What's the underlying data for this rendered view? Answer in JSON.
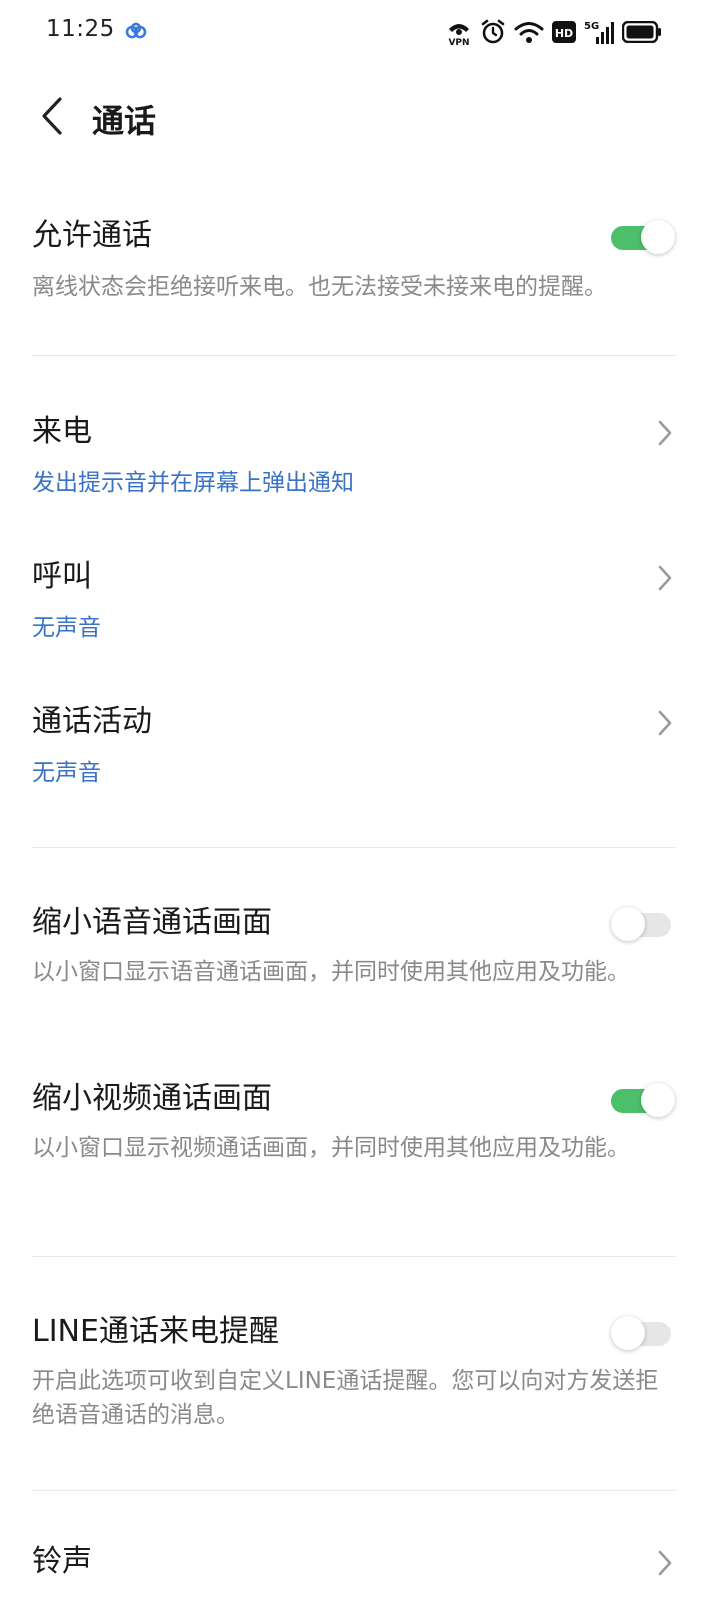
{
  "status_bar": {
    "time": "11:25",
    "icons": [
      "cloud-icon",
      "vpn-icon",
      "alarm-icon",
      "wifi-icon",
      "hd-icon",
      "5g-signal-icon",
      "battery-icon"
    ],
    "vpn_label": "VPN",
    "hd_label": "HD",
    "network_label": "5G"
  },
  "header": {
    "title": "通话",
    "back_icon": "chevron-left-icon"
  },
  "colors": {
    "toggle_on": "#4cbf6b",
    "toggle_off": "#e6e6e6",
    "value_blue": "#3a72c6",
    "desc_gray": "#8a8a8a"
  },
  "settings": {
    "allow_calls": {
      "title": "允许通话",
      "desc": "离线状态会拒绝接听来电。也无法接受未接来电的提醒。",
      "enabled": true
    },
    "incoming": {
      "title": "来电",
      "value": "发出提示音并在屏幕上弹出通知"
    },
    "outgoing": {
      "title": "呼叫",
      "value": "无声音"
    },
    "call_activity": {
      "title": "通话活动",
      "value": "无声音"
    },
    "minimize_voice": {
      "title": "缩小语音通话画面",
      "desc": "以小窗口显示语音通话画面，并同时使用其他应用及功能。",
      "enabled": false
    },
    "minimize_video": {
      "title": "缩小视频通话画面",
      "desc": "以小窗口显示视频通话画面，并同时使用其他应用及功能。",
      "enabled": true
    },
    "line_call_alert": {
      "title": "LINE通话来电提醒",
      "desc": "开启此选项可收到自定义LINE通话提醒。您可以向对方发送拒绝语音通话的消息。",
      "enabled": false
    },
    "ringtone": {
      "title": "铃声"
    }
  }
}
